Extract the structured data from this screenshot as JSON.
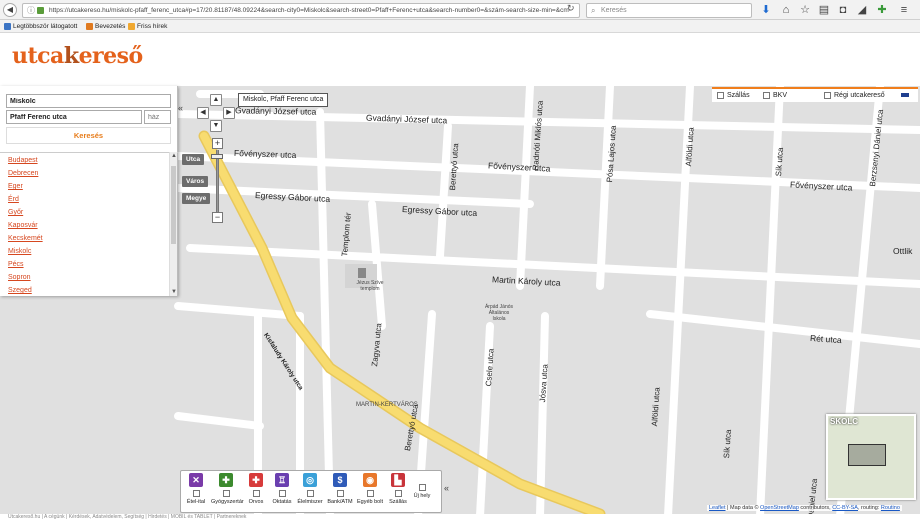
{
  "browser": {
    "url": "https://utcakereso.hu/miskolc-pfaff_ferenc_utca#p=17/20.81187/48.09224&search-city0=Miskolc&search-street0=Pfaff+Ferenc+utca&search-number0=&szám-search-size-min=&cm-",
    "search_placeholder": "Keresés",
    "reload_icon": "reload-icon"
  },
  "bookmarks": [
    {
      "label": "Legtöbbször látogatott",
      "color": "#3b74c4"
    },
    {
      "label": "Bevezetés",
      "color": "#e07a1f"
    },
    {
      "label": "Friss hírek",
      "color": "#f0a830"
    }
  ],
  "logo": {
    "part1": "utca",
    "part2": "k",
    "part3": "ereső"
  },
  "search": {
    "city_value": "Miskolc",
    "street_value": "Pfaff Ferenc utca",
    "number_placeholder": "ház",
    "button_label": "Keresés"
  },
  "cities": [
    "Budapest",
    "Debrecen",
    "Eger",
    "Érd",
    "Győr",
    "Kaposvár",
    "Kecskemét",
    "Miskolc",
    "Pécs",
    "Sopron",
    "Szeged"
  ],
  "map_controls": {
    "tooltip": "Miskolc, Pfaff Ferenc utca",
    "levels": [
      "Utca",
      "Város",
      "Megye"
    ],
    "zoom_in": "+",
    "zoom_out": "−",
    "collapse": "«"
  },
  "layers": [
    {
      "label": "Szállás"
    },
    {
      "label": "BKV"
    },
    {
      "label": "Régi utcakereső"
    }
  ],
  "streets": {
    "s1": "Gvadányi József utca",
    "s2": "Gvadányi József utca",
    "s3": "Fővényszer utca",
    "s4": "Fővényszer utca",
    "s5": "Fővényszer utca",
    "s6": "Egressy Gábor utca",
    "s7": "Egressy Gábor utca",
    "s8": "Martin Károly utca",
    "s9": "Rét utca",
    "s10": "Kisfaludy Károly utca",
    "s11": "Templom tér",
    "s12": "Zagyva utca",
    "s13": "Berettyó utca",
    "s14": "Radnóti Miklós utca",
    "s15": "Pósa Lajos utca",
    "s16": "Alföldi utca",
    "s17": "Sík utca",
    "s18": "Berzsenyi Dániel utca",
    "s19": "Csele utca",
    "s20": "Jósva utca",
    "s21": "Alföldi utca",
    "s22": "Sík utca",
    "s23": "Berettyó utca",
    "s24": "MARTIN-KERTVÁROS",
    "s25": "Jézus Szíve templom",
    "s26": "Árpád Jánós Általános Iskola",
    "s27": "Ottlik",
    "s28": "Dániel utca",
    "s29": "utca"
  },
  "poi": [
    {
      "label": "Étel-ital",
      "color": "#7a3aa8",
      "icon": "fork-icon"
    },
    {
      "label": "Gyógyszertár",
      "color": "#3c8a2e",
      "icon": "pharmacy-icon"
    },
    {
      "label": "Orvos",
      "color": "#d73b3b",
      "icon": "doctor-icon"
    },
    {
      "label": "Oktatás",
      "color": "#6a3fb0",
      "icon": "education-icon"
    },
    {
      "label": "Élelmiszer",
      "color": "#3aa0d8",
      "icon": "grocery-icon"
    },
    {
      "label": "Bank/ATM",
      "color": "#2f5bb8",
      "icon": "bank-icon"
    },
    {
      "label": "Egyéb bolt",
      "color": "#e8772a",
      "icon": "shop-icon"
    },
    {
      "label": "Szállás",
      "color": "#c8343a",
      "icon": "bed-icon"
    },
    {
      "label": "Új hely",
      "color": "#ffffff",
      "icon": "new-place-icon"
    }
  ],
  "attribution": {
    "leaflet": "Leaflet",
    "text1": " | Map data © ",
    "osm": "OpenStreetMap",
    "text2": " contributors, ",
    "license": "CC-BY-SA",
    "text3": ", routing: ",
    "routing": "Routino"
  },
  "minimap": {
    "title": "SKOLC"
  },
  "footer": "Utcakereső.hu | A cégünk | Kérdések, Adatvédelem, Segítség | Hirdetés | MOBIL és TABLET | Partnereknek"
}
